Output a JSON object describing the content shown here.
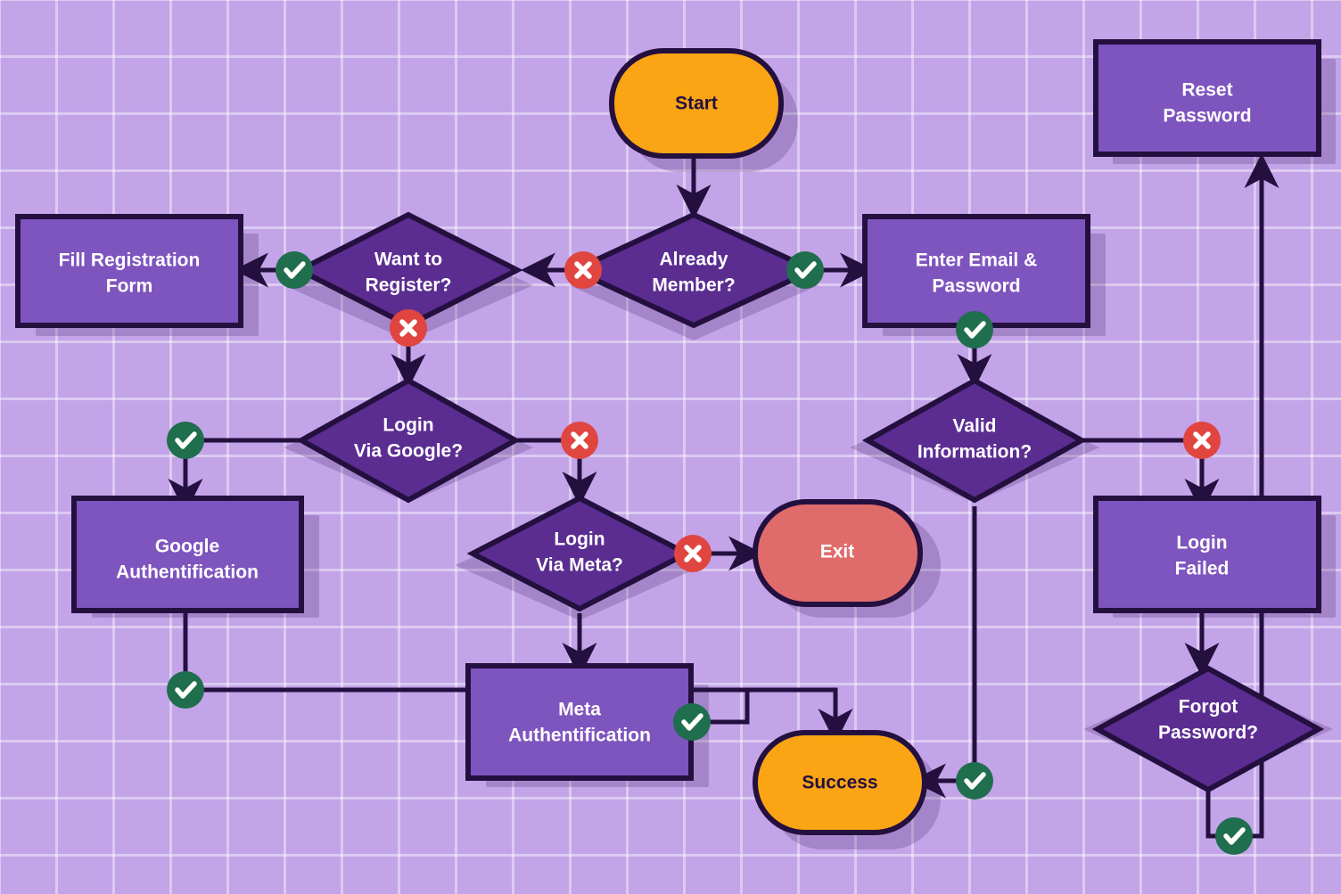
{
  "diagram": {
    "title": "Login / Registration Authentication Flowchart",
    "background_color": "#c3a4e8",
    "grid_line_color": "#d9c4f2",
    "stroke_color": "#24103f"
  },
  "palette": {
    "terminal_start": "#FBA414",
    "terminal_success": "#FBA414",
    "terminal_exit": "#E06B6B",
    "process": "#7E54BE",
    "decision": "#5B2D91",
    "badge_yes": "#1f6e4e",
    "badge_no": "#e0453f",
    "label_light": "#ffffff",
    "label_dark": "#24103f"
  },
  "nodes": [
    {
      "id": "start",
      "type": "terminal",
      "label_line1": "Start",
      "label_line2": "",
      "fill": "#FBA414",
      "text": "dark"
    },
    {
      "id": "already",
      "type": "decision",
      "label_line1": "Already",
      "label_line2": "Member?",
      "fill": "#5B2D91",
      "text": "light"
    },
    {
      "id": "want",
      "type": "decision",
      "label_line1": "Want to",
      "label_line2": "Register?",
      "fill": "#5B2D91",
      "text": "light"
    },
    {
      "id": "fillform",
      "type": "process",
      "label_line1": "Fill Registration",
      "label_line2": "Form",
      "fill": "#7E54BE",
      "text": "light"
    },
    {
      "id": "enteremail",
      "type": "process",
      "label_line1": "Enter Email &",
      "label_line2": "Password",
      "fill": "#7E54BE",
      "text": "light"
    },
    {
      "id": "resetpw",
      "type": "process",
      "label_line1": "Reset",
      "label_line2": "Password",
      "fill": "#7E54BE",
      "text": "light"
    },
    {
      "id": "googleq",
      "type": "decision",
      "label_line1": "Login",
      "label_line2": "Via Google?",
      "fill": "#5B2D91",
      "text": "light"
    },
    {
      "id": "validinfo",
      "type": "decision",
      "label_line1": "Valid",
      "label_line2": "Information?",
      "fill": "#5B2D91",
      "text": "light"
    },
    {
      "id": "googleauth",
      "type": "process",
      "label_line1": "Google",
      "label_line2": "Authentification",
      "fill": "#7E54BE",
      "text": "light"
    },
    {
      "id": "metaq",
      "type": "decision",
      "label_line1": "Login",
      "label_line2": "Via Meta?",
      "fill": "#5B2D91",
      "text": "light"
    },
    {
      "id": "exit",
      "type": "terminal",
      "label_line1": "Exit",
      "label_line2": "",
      "fill": "#E06B6B",
      "text": "light"
    },
    {
      "id": "loginfailed",
      "type": "process",
      "label_line1": "Login",
      "label_line2": "Failed",
      "fill": "#7E54BE",
      "text": "light"
    },
    {
      "id": "metaauth",
      "type": "process",
      "label_line1": "Meta",
      "label_line2": "Authentification",
      "fill": "#7E54BE",
      "text": "light"
    },
    {
      "id": "success",
      "type": "terminal",
      "label_line1": "Success",
      "label_line2": "",
      "fill": "#FBA414",
      "text": "dark"
    },
    {
      "id": "forgotpw",
      "type": "decision",
      "label_line1": "Forgot",
      "label_line2": "Password?",
      "fill": "#5B2D91",
      "text": "light"
    }
  ],
  "edges": [
    {
      "from": "start",
      "to": "already",
      "badge": "none"
    },
    {
      "from": "already",
      "to": "want",
      "badge": "no"
    },
    {
      "from": "already",
      "to": "enteremail",
      "badge": "yes"
    },
    {
      "from": "want",
      "to": "fillform",
      "badge": "yes"
    },
    {
      "from": "want",
      "to": "googleq",
      "badge": "no"
    },
    {
      "from": "googleq",
      "to": "googleauth",
      "badge": "yes"
    },
    {
      "from": "googleq",
      "to": "metaq",
      "badge": "no"
    },
    {
      "from": "googleauth",
      "to": "metaauth",
      "badge": "yes"
    },
    {
      "from": "metaq",
      "to": "exit",
      "badge": "no"
    },
    {
      "from": "metaq",
      "to": "metaauth",
      "badge": "none"
    },
    {
      "from": "metaauth",
      "to": "success",
      "badge": "yes"
    },
    {
      "from": "enteremail",
      "to": "validinfo",
      "badge": "yes"
    },
    {
      "from": "validinfo",
      "to": "loginfailed",
      "badge": "no"
    },
    {
      "from": "validinfo",
      "to": "success",
      "badge": "yes"
    },
    {
      "from": "loginfailed",
      "to": "forgotpw",
      "badge": "none"
    },
    {
      "from": "forgotpw",
      "to": "resetpw",
      "badge": "yes"
    }
  ],
  "badge_glyphs": {
    "yes": "check-mark",
    "no": "cross-mark"
  },
  "labels": {
    "start": "Start",
    "already_member": "Already Member?",
    "want_to_register": "Want to Register?",
    "fill_registration_form": "Fill Registration Form",
    "enter_email_password": "Enter Email & Password",
    "reset_password": "Reset Password",
    "login_via_google": "Login Via Google?",
    "valid_information": "Valid Information?",
    "google_authentification": "Google Authentification",
    "login_via_meta": "Login Via Meta?",
    "exit": "Exit",
    "login_failed": "Login Failed",
    "meta_authentification": "Meta Authentification",
    "success": "Success",
    "forgot_password": "Forgot Password?"
  }
}
